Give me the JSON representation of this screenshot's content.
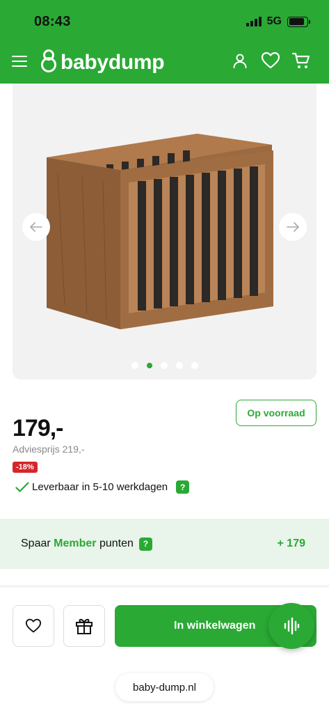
{
  "status_bar": {
    "time": "08:43",
    "network": "5G"
  },
  "header": {
    "logo_text": "babydump"
  },
  "gallery": {
    "dot_count": 5,
    "active_dot": 2
  },
  "product": {
    "stock_label": "Op voorraad",
    "price": "179,-",
    "advice_price": "Adviesprijs 219,-",
    "discount": "-18%",
    "delivery": "Leverbaar in 5-10 werkdagen",
    "help_mark": "?"
  },
  "member": {
    "prefix": "Spaar",
    "highlight": "Member",
    "suffix": "punten",
    "help_mark": "?",
    "points": "+ 179"
  },
  "actions": {
    "cart_label": "In winkelwagen"
  },
  "browser": {
    "url": "baby-dump.nl"
  },
  "colors": {
    "brand_green": "#2aa935",
    "discount_red": "#d7262b",
    "member_bg": "#e9f4ea"
  }
}
